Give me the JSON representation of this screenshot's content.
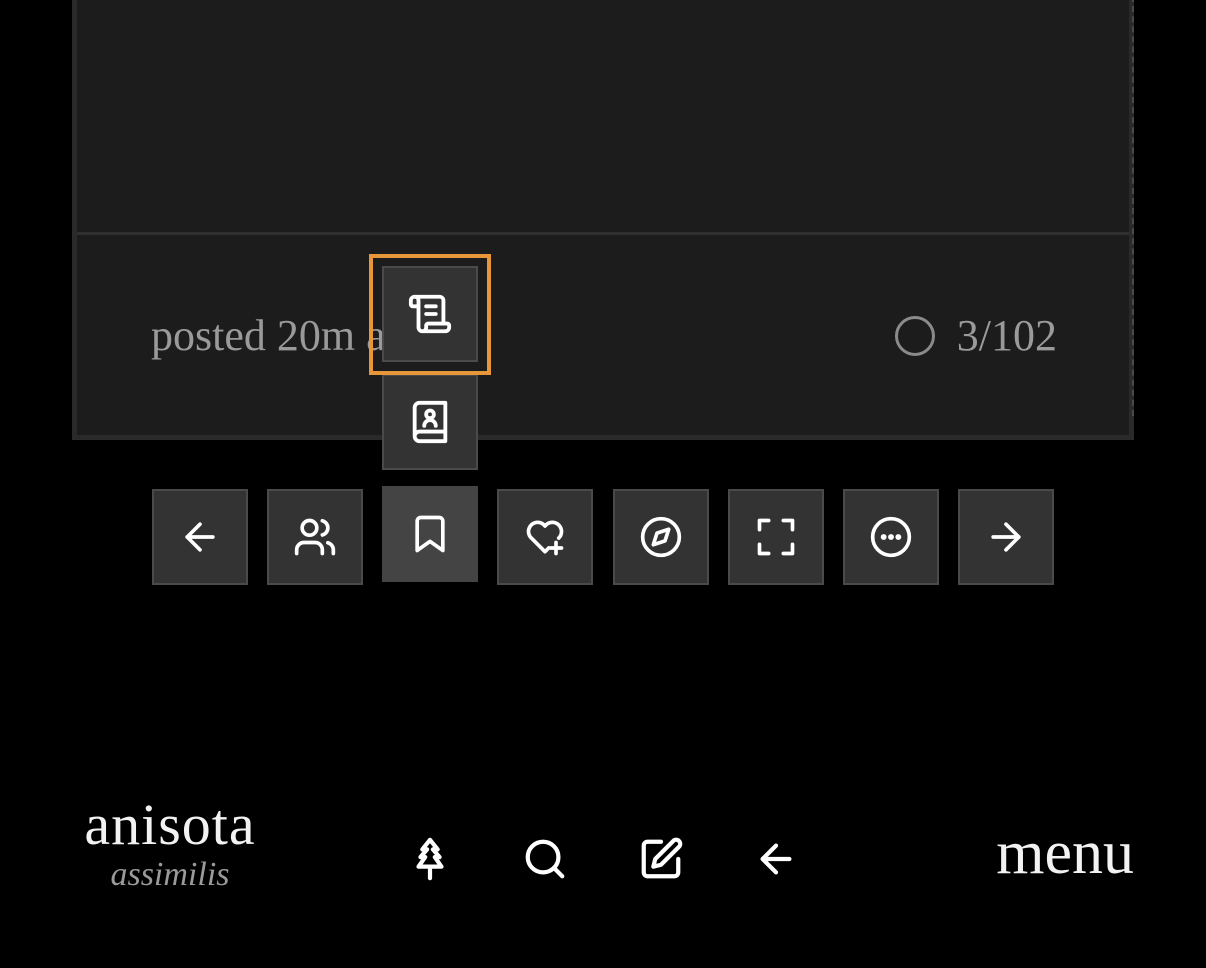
{
  "post": {
    "meta_text": "posted 20m ago",
    "reply_count": "3/102"
  },
  "popup": {
    "items": [
      {
        "icon": "scroll-icon",
        "label": ""
      },
      {
        "icon": "contact-book-icon",
        "label": ""
      }
    ]
  },
  "toolbar": {
    "buttons": [
      {
        "icon": "arrow-left-icon"
      },
      {
        "icon": "users-icon"
      },
      {
        "icon": "bookmark-icon",
        "active": true
      },
      {
        "icon": "heart-plus-icon"
      },
      {
        "icon": "compass-icon"
      },
      {
        "icon": "fullscreen-icon"
      },
      {
        "icon": "more-horizontal-icon"
      },
      {
        "icon": "arrow-right-icon"
      }
    ]
  },
  "footer": {
    "brand_name": "anisota",
    "brand_sub": "assimilis",
    "menu_label": "menu",
    "nav_icons": [
      "tree-icon",
      "search-icon",
      "edit-icon",
      "back-arrow-icon"
    ]
  },
  "colors": {
    "background": "#000000",
    "card": "#1c1c1c",
    "button": "#333333",
    "focus": "#e8963a"
  }
}
